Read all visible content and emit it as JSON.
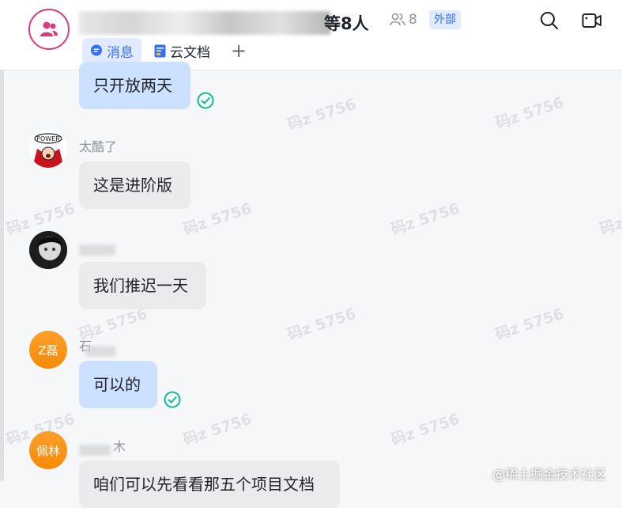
{
  "header": {
    "title_suffix": "等8人",
    "member_count": "8",
    "external_tag": "外部"
  },
  "tabs": [
    {
      "label": "消息",
      "active": true
    },
    {
      "label": "云文档",
      "active": false
    }
  ],
  "messages": [
    {
      "sender": "",
      "text": "只开放两天",
      "mine": true,
      "read": true
    },
    {
      "sender": "太酷了",
      "text": "这是进阶版",
      "mine": false
    },
    {
      "sender": "",
      "text": "我们推迟一天",
      "mine": false
    },
    {
      "sender": "石",
      "avatar_text": "Z磊",
      "text": "可以的",
      "mine": true,
      "read": true
    },
    {
      "sender": "木",
      "avatar_text": "佩林",
      "text": "咱们可以先看看那五个项目文档",
      "mine": false
    }
  ],
  "watermark": "码z 5756",
  "site_mark": "@稀土掘金技术社区",
  "colors": {
    "accent": "#3370ff",
    "group_ring": "#d63b82",
    "bubble_mine": "#cce0ff",
    "bubble_theirs": "#eaebed",
    "read_check": "#14b89a",
    "avatar_orange": "#f58a07"
  },
  "icons": {
    "group": "group-users-icon",
    "members": "members-icon",
    "search": "search-icon",
    "video": "video-call-icon",
    "messages_tab": "chat-bubble-icon",
    "docs_tab": "doc-icon",
    "add": "plus-icon",
    "read": "read-check-icon"
  }
}
